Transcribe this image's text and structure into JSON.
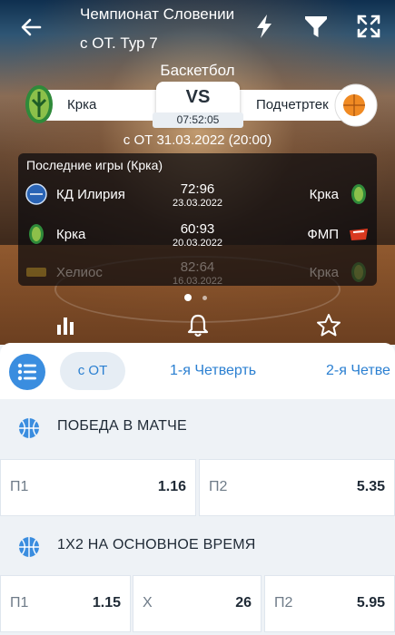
{
  "header": {
    "title_line1": "Чемпионат Словении",
    "title_line2": "с ОТ. Тур 7",
    "icons": [
      "back-arrow-icon",
      "lightning-icon",
      "filter-icon",
      "expand-icon"
    ]
  },
  "match": {
    "sport": "Баскетбол",
    "team1": "Крка",
    "team2": "Подчетртек",
    "vs": "VS",
    "timer": "07:52:05",
    "datetime": "с ОТ 31.03.2022 (20:00)"
  },
  "last_games": {
    "title": "Последние игры (Крка)",
    "rows": [
      {
        "home": "КД Илирия",
        "score": "72:96",
        "date": "23.03.2022",
        "away": "Крка"
      },
      {
        "home": "Крка",
        "score": "60:93",
        "date": "20.03.2022",
        "away": "ФМП"
      },
      {
        "home": "Хелиос",
        "score": "82:64",
        "date": "16.03.2022",
        "away": "Крка"
      }
    ]
  },
  "hero_tabs": [
    "stats-icon",
    "bell-icon",
    "star-icon"
  ],
  "market_tabs": {
    "menu_icon": "list-icon",
    "active": "с ОТ",
    "items": [
      "1-я Четверть",
      "2-я Четве"
    ]
  },
  "markets": [
    {
      "title": "ПОБЕДА В МАТЧЕ",
      "odds": [
        {
          "label": "П1",
          "value": "1.16"
        },
        {
          "label": "П2",
          "value": "5.35"
        }
      ]
    },
    {
      "title": "1Х2 НА ОСНОВНОЕ ВРЕМЯ",
      "odds": [
        {
          "label": "П1",
          "value": "1.15"
        },
        {
          "label": "Х",
          "value": "26"
        },
        {
          "label": "П2",
          "value": "5.95"
        }
      ]
    }
  ],
  "colors": {
    "accent": "#2a7fd1",
    "menu_button": "#3a8ddf",
    "panel_bg": "#eef2f6"
  }
}
